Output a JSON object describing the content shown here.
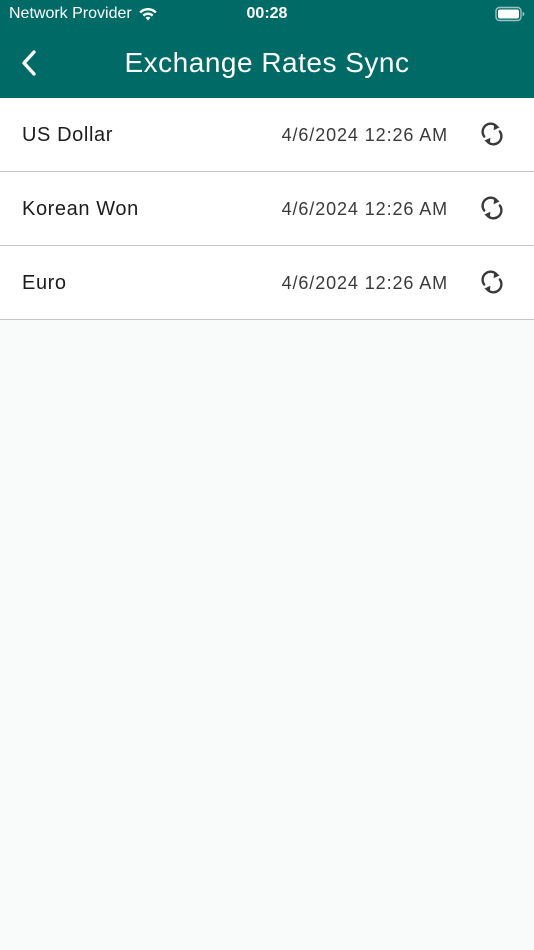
{
  "status_bar": {
    "carrier": "Network Provider",
    "time": "00:28"
  },
  "nav": {
    "title": "Exchange Rates Sync",
    "back_icon": "chevron-left-icon"
  },
  "rates": [
    {
      "currency": "US Dollar",
      "last_sync": "4/6/2024 12:26 AM",
      "icon": "sync-icon"
    },
    {
      "currency": "Korean Won",
      "last_sync": "4/6/2024 12:26 AM",
      "icon": "sync-icon"
    },
    {
      "currency": "Euro",
      "last_sync": "4/6/2024 12:26 AM",
      "icon": "sync-icon"
    }
  ],
  "colors": {
    "header": "#006b66",
    "background": "#f9fbfb",
    "row": "#ffffff",
    "divider": "#c6c6c8",
    "text_primary": "#1c1c1e",
    "text_secondary": "#3a3a3c"
  }
}
